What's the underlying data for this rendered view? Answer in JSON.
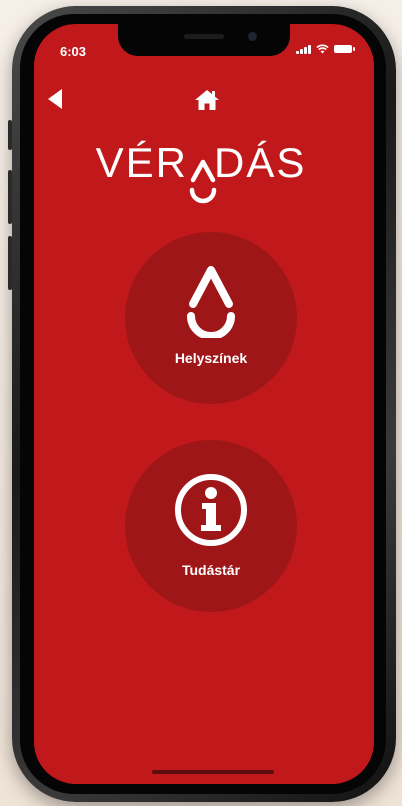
{
  "status_bar": {
    "time": "6:03"
  },
  "nav": {
    "back_icon": "back-arrow-icon",
    "home_icon": "home-icon"
  },
  "logo": {
    "left_text": "VÉR",
    "right_text": "DÁS",
    "drop_icon": "blood-drop-icon"
  },
  "menu": {
    "items": [
      {
        "label": "Helyszínek",
        "icon": "blood-drop-icon"
      },
      {
        "label": "Tudástár",
        "icon": "info-icon"
      }
    ]
  },
  "colors": {
    "primary_red": "#c1191b",
    "circle_red": "#9e1618",
    "foreground": "#ffffff"
  }
}
